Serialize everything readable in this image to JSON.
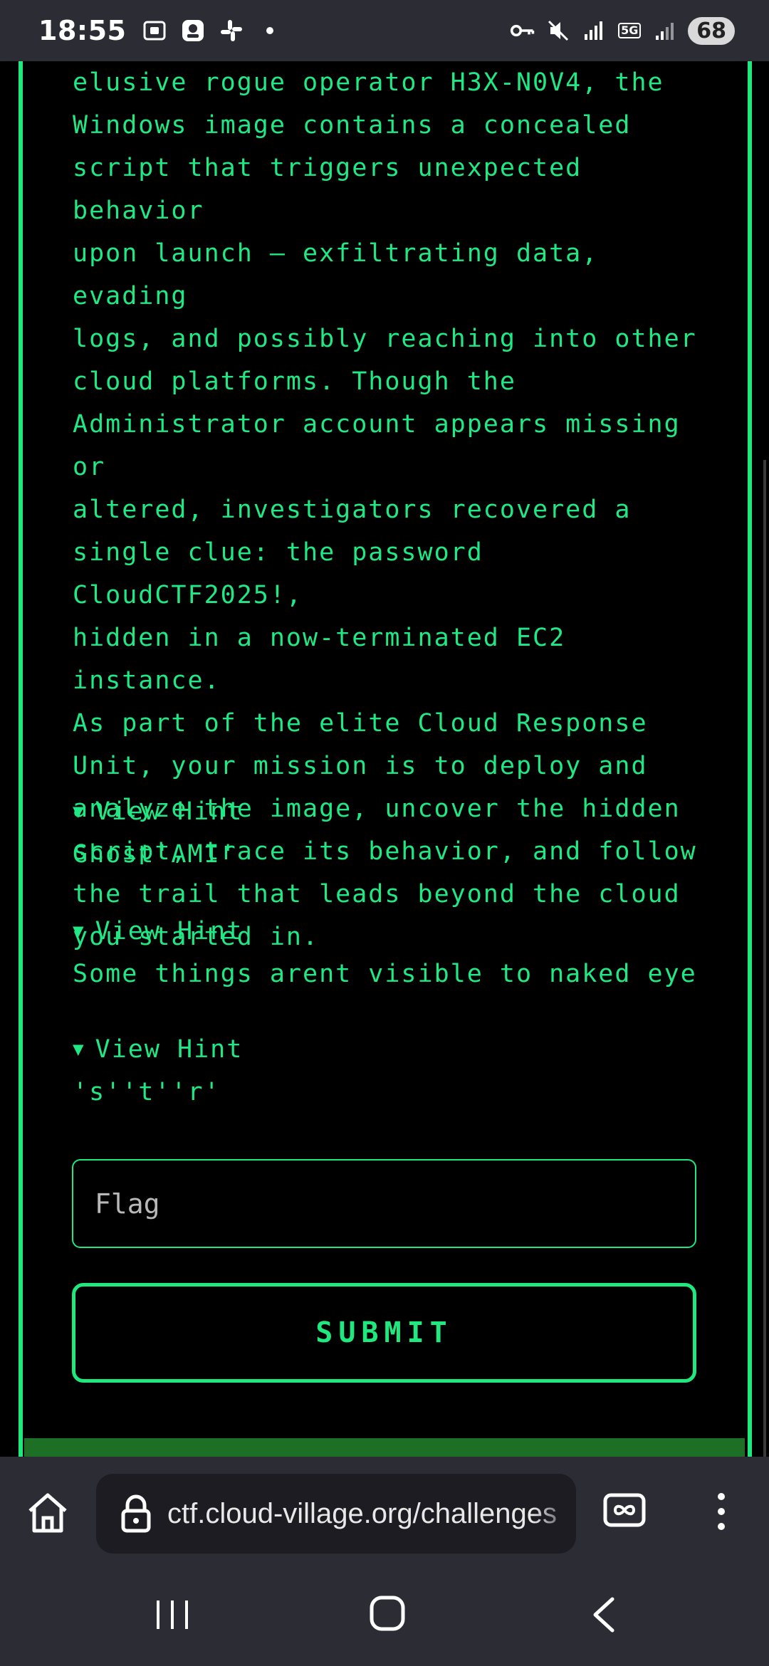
{
  "status_bar": {
    "time": "18:55",
    "battery": "68",
    "network_badge": "5G",
    "left_icons": [
      "screenshot-icon",
      "assistant-icon",
      "slack-icon",
      "dot-icon"
    ],
    "right_icons": [
      "vpn-key-icon",
      "mute-icon",
      "signal-icon",
      "5g-data-icon",
      "signal-bars-icon",
      "battery-icon"
    ]
  },
  "challenge": {
    "description_lines": [
      "elusive rogue operator H3X-N0V4, the",
      "Windows image contains a concealed",
      "script that triggers unexpected behavior",
      "upon launch — exfiltrating data, evading",
      "logs, and possibly reaching into other",
      "cloud platforms. Though the",
      "Administrator account appears missing or",
      "altered, investigators recovered a",
      "single clue: the password CloudCTF2025!,",
      "hidden in a now-terminated EC2 instance.",
      "As part of the elite Cloud Response",
      "Unit, your mission is to deploy and",
      "analyze the image, uncover the hidden",
      "script, trace its behavior, and follow",
      "the trail that leads beyond the cloud",
      "you started in."
    ],
    "hints": [
      {
        "label": "View Hint",
        "text": "Ghost'AMI'"
      },
      {
        "label": "View Hint",
        "text": "Some things arent visible to naked eye"
      },
      {
        "label": "View Hint",
        "text": "'s''t''r'"
      }
    ],
    "hint_arrow": "▼",
    "flag_placeholder": "Flag",
    "submit_label": "SUBMIT"
  },
  "browser": {
    "url": "ctf.cloud-village.org/challenges"
  },
  "colors": {
    "accent": "#1fe87f",
    "text": "#20e884",
    "background": "#000000",
    "chrome": "#2c2c34"
  }
}
